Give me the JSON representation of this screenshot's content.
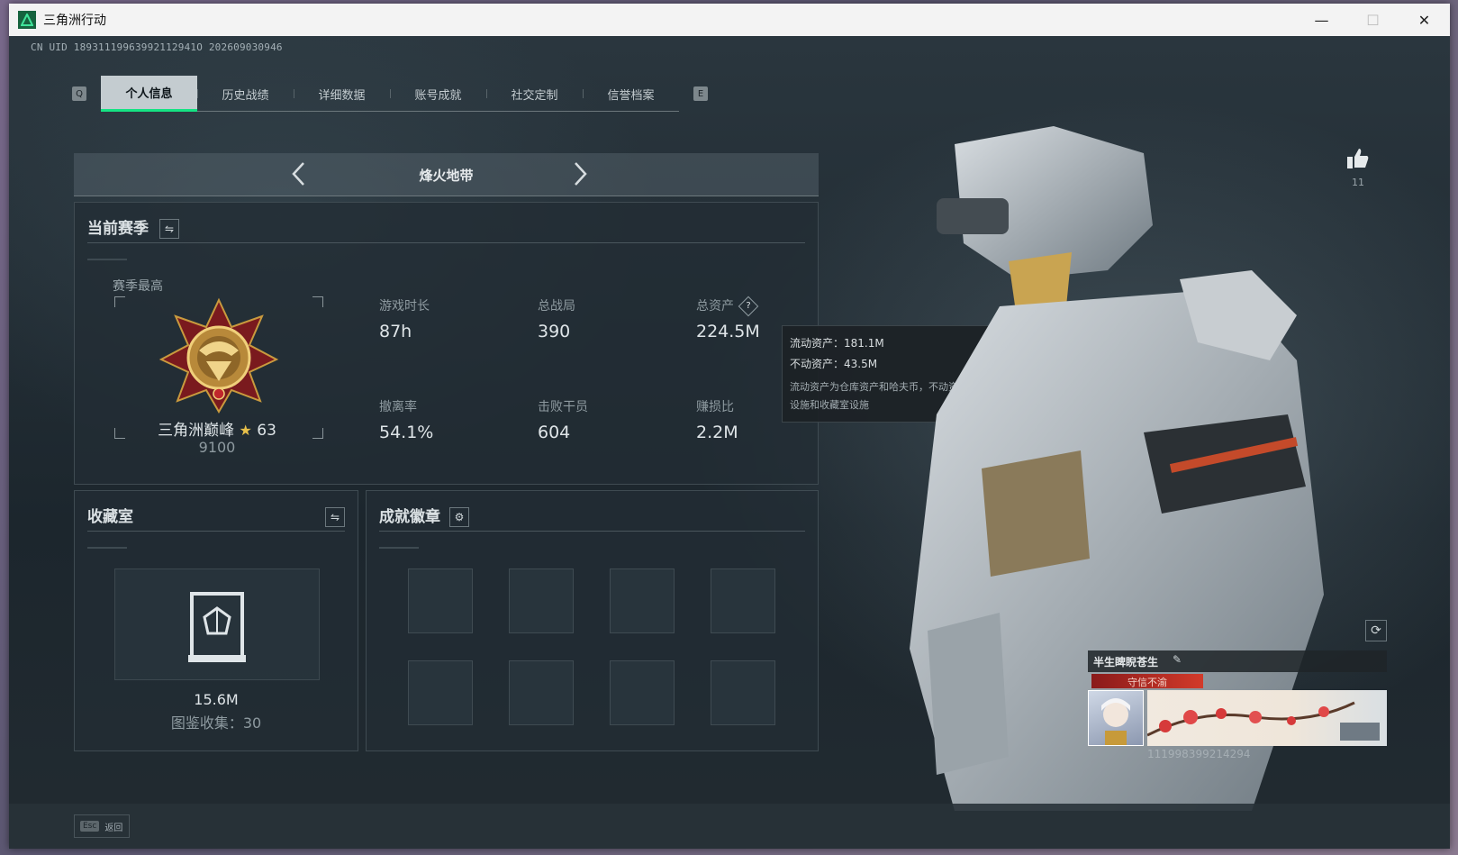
{
  "window": {
    "title": "三角洲行动",
    "controls": {
      "minimize": "—",
      "maximize": "☐",
      "close": "✕"
    }
  },
  "uid": "CN UID 18931119963992112941O 202609030946",
  "tabs": {
    "left_key": "Q",
    "right_key": "E",
    "items": [
      "个人信息",
      "历史战绩",
      "详细数据",
      "账号成就",
      "社交定制",
      "信誉档案"
    ],
    "active_index": 0
  },
  "mode": {
    "title": "烽火地带",
    "prev": "‹",
    "next": "›"
  },
  "season": {
    "title": "当前赛季",
    "switch_icon": "swap-icon",
    "highest_label": "赛季最高",
    "rank_name": "三角洲巅峰",
    "rank_stars": "63",
    "rank_points": "9100",
    "stats": [
      {
        "label": "游戏时长",
        "value": "87h"
      },
      {
        "label": "总战局",
        "value": "390"
      },
      {
        "label": "总资产",
        "value": "224.5M"
      },
      {
        "label": "撤离率",
        "value": "54.1%"
      },
      {
        "label": "击败干员",
        "value": "604"
      },
      {
        "label": "赚损比",
        "value": "2.2M"
      }
    ],
    "help_icon": "?"
  },
  "tooltip": {
    "liquid": "流动资产：181.1M",
    "fixed": "不动资产：43.5M",
    "desc": "流动资产为仓库资产和哈夫币，不动资产为特勤处设施和收藏室设施"
  },
  "collection": {
    "title": "收藏室",
    "value": "15.6M",
    "count_label": "图鉴收集：30"
  },
  "achievements": {
    "title": "成就徽章",
    "settings_icon": "gear-icon"
  },
  "profile": {
    "like_count": "11",
    "nickname": "半生睥睨苍生",
    "motto": "守信不渝",
    "card_uid": "111998399214294"
  },
  "bottom": {
    "esc_key": "Esc",
    "back_label": "返回"
  },
  "colors": {
    "accent": "#15e383",
    "active_tab": "#c4ccd0",
    "panel": "#222d35"
  }
}
